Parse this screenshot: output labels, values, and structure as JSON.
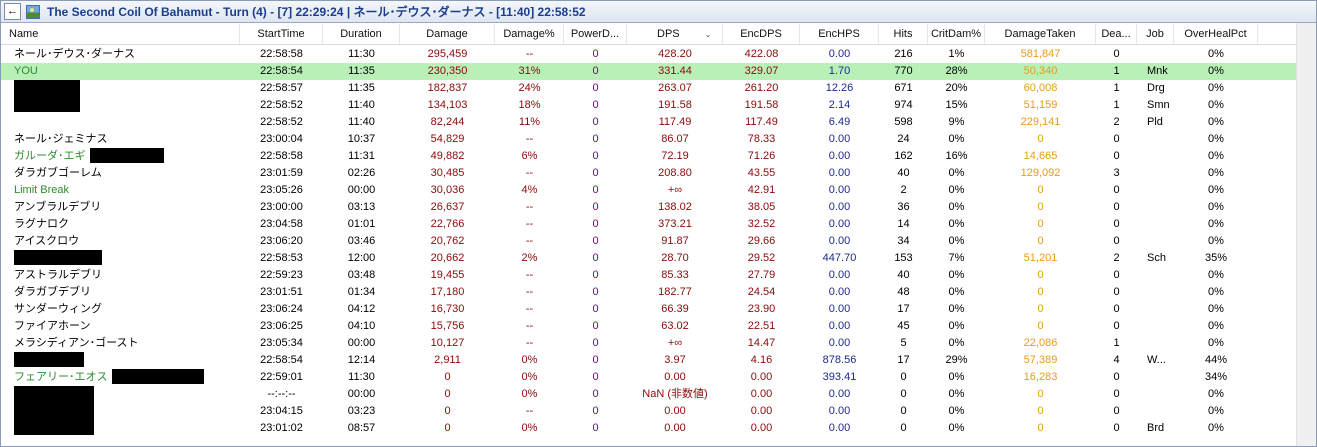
{
  "window": {
    "title": "The Second Coil Of Bahamut - Turn (4) - [7] 22:29:24 | ネール･デウス･ダーナス - [11:40] 22:58:52",
    "back_glyph": "←"
  },
  "columns": [
    "Name",
    "StartTime",
    "Duration",
    "Damage",
    "Damage%",
    "PowerD...",
    "DPS",
    "EncDPS",
    "EncHPS",
    "Hits",
    "CritDam%",
    "DamageTaken",
    "Dea...",
    "Job",
    "OverHealPct"
  ],
  "sort_glyph": "⌄",
  "colors": {
    "highlight_row": "#b8f0b8",
    "green_name": "#2f8a2f",
    "damage": "#8a0a0a",
    "power": "#800080",
    "heal": "#1c2a8c",
    "taken": "#e89b1a"
  },
  "rows": [
    {
      "name": "ネール･デウス･ダーナス",
      "name_style": "black",
      "redact": 0,
      "redact_h": 15,
      "start": "22:58:58",
      "duration": "11:30",
      "damage": "295,459",
      "damage_pct": "--",
      "power": "0",
      "dps": "428.20",
      "encdps": "422.08",
      "enchps": "0.00",
      "hits": "216",
      "crit": "1%",
      "taken": "581,847",
      "deaths": "0",
      "job": "",
      "overheal": "0%",
      "hl": false
    },
    {
      "name": "YOU",
      "name_style": "green",
      "redact": 0,
      "redact_h": 15,
      "start": "22:58:54",
      "duration": "11:35",
      "damage": "230,350",
      "damage_pct": "31%",
      "power": "0",
      "dps": "331.44",
      "encdps": "329.07",
      "enchps": "1.70",
      "hits": "770",
      "crit": "28%",
      "taken": "50,340",
      "deaths": "1",
      "job": "Mnk",
      "overheal": "0%",
      "hl": true
    },
    {
      "name": "",
      "name_style": "black",
      "redact": 66,
      "redact_h": 32,
      "start": "22:58:57",
      "duration": "11:35",
      "damage": "182,837",
      "damage_pct": "24%",
      "power": "0",
      "dps": "263.07",
      "encdps": "261.20",
      "enchps": "12.26",
      "hits": "671",
      "crit": "20%",
      "taken": "60,008",
      "deaths": "1",
      "job": "Drg",
      "overheal": "0%",
      "hl": false
    },
    {
      "name": "",
      "name_style": "black",
      "redact": 0,
      "redact_h": 15,
      "start": "22:58:52",
      "duration": "11:40",
      "damage": "134,103",
      "damage_pct": "18%",
      "power": "0",
      "dps": "191.58",
      "encdps": "191.58",
      "enchps": "2.14",
      "hits": "974",
      "crit": "15%",
      "taken": "51,159",
      "deaths": "1",
      "job": "Smn",
      "overheal": "0%",
      "hl": false
    },
    {
      "name": "",
      "name_style": "black",
      "redact": 0,
      "redact_h": 15,
      "start": "22:58:52",
      "duration": "11:40",
      "damage": "82,244",
      "damage_pct": "11%",
      "power": "0",
      "dps": "117.49",
      "encdps": "117.49",
      "enchps": "6.49",
      "hits": "598",
      "crit": "9%",
      "taken": "229,141",
      "deaths": "2",
      "job": "Pld",
      "overheal": "0%",
      "hl": false
    },
    {
      "name": "ネール･ジェミナス",
      "name_style": "black",
      "redact": 0,
      "redact_h": 15,
      "start": "23:00:04",
      "duration": "10:37",
      "damage": "54,829",
      "damage_pct": "--",
      "power": "0",
      "dps": "86.07",
      "encdps": "78.33",
      "enchps": "0.00",
      "hits": "24",
      "crit": "0%",
      "taken": "0",
      "deaths": "0",
      "job": "",
      "overheal": "0%",
      "hl": false
    },
    {
      "name": "ガルーダ･エギ",
      "name_style": "green",
      "redact": 74,
      "redact_h": 15,
      "start": "22:58:58",
      "duration": "11:31",
      "damage": "49,882",
      "damage_pct": "6%",
      "power": "0",
      "dps": "72.19",
      "encdps": "71.26",
      "enchps": "0.00",
      "hits": "162",
      "crit": "16%",
      "taken": "14,665",
      "deaths": "0",
      "job": "",
      "overheal": "0%",
      "hl": false
    },
    {
      "name": "ダラガブゴーレム",
      "name_style": "black",
      "redact": 0,
      "redact_h": 15,
      "start": "23:01:59",
      "duration": "02:26",
      "damage": "30,485",
      "damage_pct": "--",
      "power": "0",
      "dps": "208.80",
      "encdps": "43.55",
      "enchps": "0.00",
      "hits": "40",
      "crit": "0%",
      "taken": "129,092",
      "deaths": "3",
      "job": "",
      "overheal": "0%",
      "hl": false
    },
    {
      "name": "Limit Break",
      "name_style": "green",
      "redact": 0,
      "redact_h": 15,
      "start": "23:05:26",
      "duration": "00:00",
      "damage": "30,036",
      "damage_pct": "4%",
      "power": "0",
      "dps": "+∞",
      "encdps": "42.91",
      "enchps": "0.00",
      "hits": "2",
      "crit": "0%",
      "taken": "0",
      "deaths": "0",
      "job": "",
      "overheal": "0%",
      "hl": false
    },
    {
      "name": "アンブラルデブリ",
      "name_style": "black",
      "redact": 0,
      "redact_h": 15,
      "start": "23:00:00",
      "duration": "03:13",
      "damage": "26,637",
      "damage_pct": "--",
      "power": "0",
      "dps": "138.02",
      "encdps": "38.05",
      "enchps": "0.00",
      "hits": "36",
      "crit": "0%",
      "taken": "0",
      "deaths": "0",
      "job": "",
      "overheal": "0%",
      "hl": false
    },
    {
      "name": "ラグナロク",
      "name_style": "black",
      "redact": 0,
      "redact_h": 15,
      "start": "23:04:58",
      "duration": "01:01",
      "damage": "22,766",
      "damage_pct": "--",
      "power": "0",
      "dps": "373.21",
      "encdps": "32.52",
      "enchps": "0.00",
      "hits": "14",
      "crit": "0%",
      "taken": "0",
      "deaths": "0",
      "job": "",
      "overheal": "0%",
      "hl": false
    },
    {
      "name": "アイスクロウ",
      "name_style": "black",
      "redact": 0,
      "redact_h": 15,
      "start": "23:06:20",
      "duration": "03:46",
      "damage": "20,762",
      "damage_pct": "--",
      "power": "0",
      "dps": "91.87",
      "encdps": "29.66",
      "enchps": "0.00",
      "hits": "34",
      "crit": "0%",
      "taken": "0",
      "deaths": "0",
      "job": "",
      "overheal": "0%",
      "hl": false
    },
    {
      "name": "",
      "name_style": "black",
      "redact": 88,
      "redact_h": 15,
      "start": "22:58:53",
      "duration": "12:00",
      "damage": "20,662",
      "damage_pct": "2%",
      "power": "0",
      "dps": "28.70",
      "encdps": "29.52",
      "enchps": "447.70",
      "hits": "153",
      "crit": "7%",
      "taken": "51,201",
      "deaths": "2",
      "job": "Sch",
      "overheal": "35%",
      "hl": false
    },
    {
      "name": "アストラルデブリ",
      "name_style": "black",
      "redact": 0,
      "redact_h": 15,
      "start": "22:59:23",
      "duration": "03:48",
      "damage": "19,455",
      "damage_pct": "--",
      "power": "0",
      "dps": "85.33",
      "encdps": "27.79",
      "enchps": "0.00",
      "hits": "40",
      "crit": "0%",
      "taken": "0",
      "deaths": "0",
      "job": "",
      "overheal": "0%",
      "hl": false
    },
    {
      "name": "ダラガブデブリ",
      "name_style": "black",
      "redact": 0,
      "redact_h": 15,
      "start": "23:01:51",
      "duration": "01:34",
      "damage": "17,180",
      "damage_pct": "--",
      "power": "0",
      "dps": "182.77",
      "encdps": "24.54",
      "enchps": "0.00",
      "hits": "48",
      "crit": "0%",
      "taken": "0",
      "deaths": "0",
      "job": "",
      "overheal": "0%",
      "hl": false
    },
    {
      "name": "サンダーウィング",
      "name_style": "black",
      "redact": 0,
      "redact_h": 15,
      "start": "23:06:24",
      "duration": "04:12",
      "damage": "16,730",
      "damage_pct": "--",
      "power": "0",
      "dps": "66.39",
      "encdps": "23.90",
      "enchps": "0.00",
      "hits": "17",
      "crit": "0%",
      "taken": "0",
      "deaths": "0",
      "job": "",
      "overheal": "0%",
      "hl": false
    },
    {
      "name": "ファイアホーン",
      "name_style": "black",
      "redact": 0,
      "redact_h": 15,
      "start": "23:06:25",
      "duration": "04:10",
      "damage": "15,756",
      "damage_pct": "--",
      "power": "0",
      "dps": "63.02",
      "encdps": "22.51",
      "enchps": "0.00",
      "hits": "45",
      "crit": "0%",
      "taken": "0",
      "deaths": "0",
      "job": "",
      "overheal": "0%",
      "hl": false
    },
    {
      "name": "メラシディアン･ゴースト",
      "name_style": "black",
      "redact": 0,
      "redact_h": 15,
      "start": "23:05:34",
      "duration": "00:00",
      "damage": "10,127",
      "damage_pct": "--",
      "power": "0",
      "dps": "+∞",
      "encdps": "14.47",
      "enchps": "0.00",
      "hits": "5",
      "crit": "0%",
      "taken": "22,086",
      "deaths": "1",
      "job": "",
      "overheal": "0%",
      "hl": false
    },
    {
      "name": "",
      "name_style": "black",
      "redact": 70,
      "redact_h": 15,
      "start": "22:58:54",
      "duration": "12:14",
      "damage": "2,911",
      "damage_pct": "0%",
      "power": "0",
      "dps": "3.97",
      "encdps": "4.16",
      "enchps": "878.56",
      "hits": "17",
      "crit": "29%",
      "taken": "57,389",
      "deaths": "4",
      "job": "W...",
      "overheal": "44%",
      "hl": false
    },
    {
      "name": "フェアリー･エオス",
      "name_style": "green",
      "redact": 92,
      "redact_h": 15,
      "start": "22:59:01",
      "duration": "11:30",
      "damage": "0",
      "damage_pct": "0%",
      "power": "0",
      "dps": "0.00",
      "encdps": "0.00",
      "enchps": "393.41",
      "hits": "0",
      "crit": "0%",
      "taken": "16,283",
      "deaths": "0",
      "job": "",
      "overheal": "34%",
      "hl": false
    },
    {
      "name": "",
      "name_style": "black",
      "redact": 80,
      "redact_h": 49,
      "start": "--:--:--",
      "duration": "00:00",
      "damage": "0",
      "damage_pct": "0%",
      "power": "0",
      "dps": "NaN (非数値)",
      "encdps": "0.00",
      "enchps": "0.00",
      "hits": "0",
      "crit": "0%",
      "taken": "0",
      "deaths": "0",
      "job": "",
      "overheal": "0%",
      "hl": false
    },
    {
      "name": "",
      "name_style": "black",
      "redact": 0,
      "redact_h": 15,
      "start": "23:04:15",
      "duration": "03:23",
      "damage": "0",
      "damage_pct": "--",
      "power": "0",
      "dps": "0.00",
      "encdps": "0.00",
      "enchps": "0.00",
      "hits": "0",
      "crit": "0%",
      "taken": "0",
      "deaths": "0",
      "job": "",
      "overheal": "0%",
      "hl": false
    },
    {
      "name": "",
      "name_style": "black",
      "redact": 0,
      "redact_h": 15,
      "start": "23:01:02",
      "duration": "08:57",
      "damage": "0",
      "damage_pct": "0%",
      "power": "0",
      "dps": "0.00",
      "encdps": "0.00",
      "enchps": "0.00",
      "hits": "0",
      "crit": "0%",
      "taken": "0",
      "deaths": "0",
      "job": "Brd",
      "overheal": "0%",
      "hl": false
    }
  ]
}
